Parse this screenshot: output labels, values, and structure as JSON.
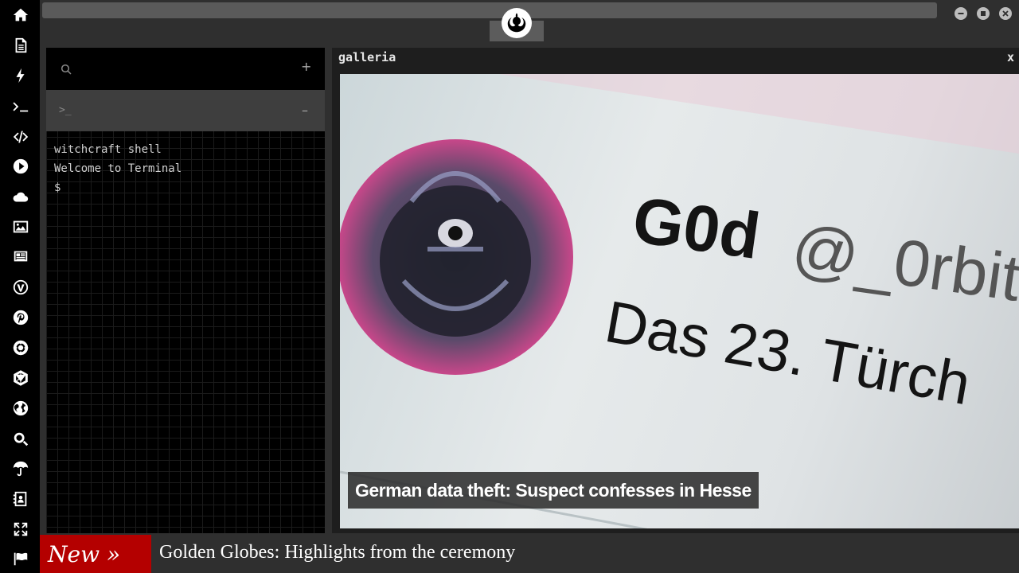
{
  "dock": {
    "icons": [
      "home-icon",
      "document-icon",
      "bolt-icon",
      "terminal-icon",
      "code-icon",
      "play-icon",
      "cloud-icon",
      "image-icon",
      "news-icon",
      "wordpress-icon",
      "pinterest-icon",
      "settings-icon",
      "network-icon",
      "globe-icon",
      "search-icon",
      "umbrella-icon",
      "contacts-icon",
      "expand-icon",
      "flag-icon"
    ]
  },
  "terminal": {
    "search_placeholder": "",
    "add_label": "+",
    "tab_icon": ">_",
    "minimize_label": "–",
    "output": [
      "witchcraft shell",
      "Welcome to Terminal",
      "$"
    ]
  },
  "galleria": {
    "title": "galleria",
    "close_label": "x",
    "caption": "German data theft: Suspect confesses in Hesse",
    "image_text": {
      "name": "G0d",
      "handle": "@_0rbit",
      "line2": "Das 23. Türch"
    }
  },
  "ticker": {
    "badge": "New »",
    "headline": "Golden Globes: Highlights from the ceremony"
  },
  "colors": {
    "dock_bg": "#000000",
    "ticker_badge": "#b40000",
    "panel_bg": "#2f2f2f"
  }
}
